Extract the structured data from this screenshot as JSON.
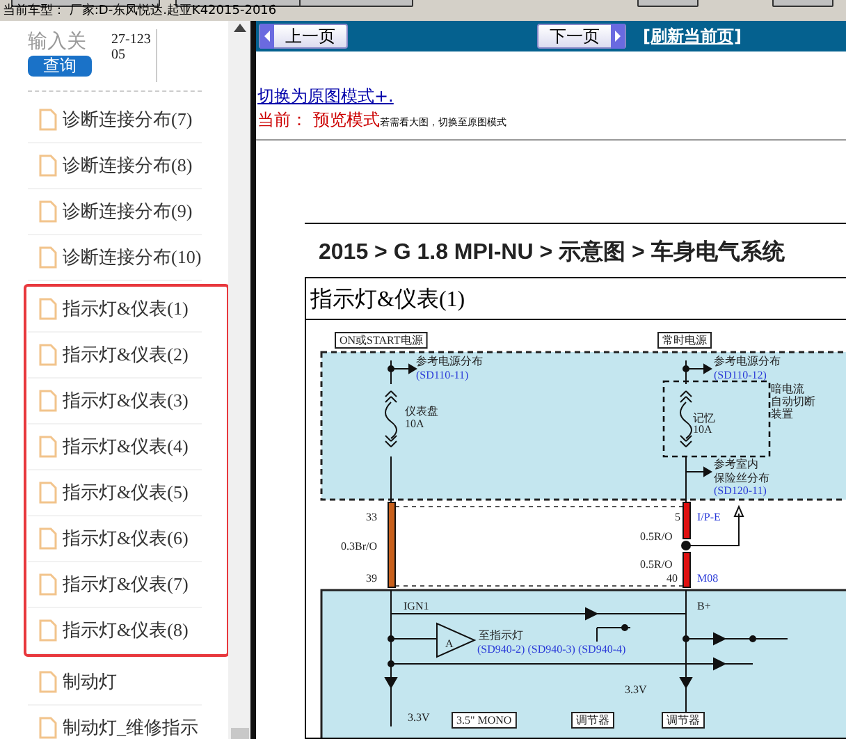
{
  "vehicle_info": "当前车型：  厂家:D-东风悦达.起亚K42015-2016",
  "sidebar": {
    "search": {
      "placeholder": "输入关",
      "value": "27-12305",
      "button": "查询"
    },
    "groups": [
      {
        "highlighted": false,
        "items": [
          "诊断连接分布(7)",
          "诊断连接分布(8)",
          "诊断连接分布(9)",
          "诊断连接分布(10)"
        ]
      },
      {
        "highlighted": true,
        "items": [
          "指示灯&仪表(1)",
          "指示灯&仪表(2)",
          "指示灯&仪表(3)",
          "指示灯&仪表(4)",
          "指示灯&仪表(5)",
          "指示灯&仪表(6)",
          "指示灯&仪表(7)",
          "指示灯&仪表(8)"
        ]
      },
      {
        "highlighted": false,
        "items": [
          "制动灯",
          "制动灯_维修指示"
        ]
      }
    ]
  },
  "viewer": {
    "prev_button": "上一页",
    "next_button": "下一页",
    "refresh_link": "[刷新当前页]",
    "mode_link": "切换为原图模式+.",
    "mode_label": "当前： 预览模式",
    "mode_hint": "若需看大图，切换至原图模式",
    "document": {
      "breadcrumb": "2015 > G 1.8 MPI-NU > 示意图 > 车身电气系统",
      "section_title": "指示灯&仪表(1)",
      "labels": [
        {
          "kind": "boxed",
          "text": "ON或START电源"
        },
        {
          "kind": "boxed",
          "text": "常时电源"
        },
        {
          "kind": "text",
          "text": "参考电源分布"
        },
        {
          "kind": "ref",
          "text": "(SD110-11)"
        },
        {
          "kind": "text",
          "text": "仪表盘"
        },
        {
          "kind": "text",
          "text": "10A"
        },
        {
          "kind": "text",
          "text": "参考电源分布"
        },
        {
          "kind": "ref",
          "text": "(SD110-12)"
        },
        {
          "kind": "text",
          "text": "暗电流"
        },
        {
          "kind": "text",
          "text": "自动切断"
        },
        {
          "kind": "text",
          "text": "装置"
        },
        {
          "kind": "text",
          "text": "记忆"
        },
        {
          "kind": "text",
          "text": "10A"
        },
        {
          "kind": "text",
          "text": "参考室内"
        },
        {
          "kind": "text",
          "text": "保险丝分布"
        },
        {
          "kind": "ref",
          "text": "(SD120-11)"
        },
        {
          "kind": "text",
          "text": "33"
        },
        {
          "kind": "text",
          "text": "0.3Br/O"
        },
        {
          "kind": "text",
          "text": "39"
        },
        {
          "kind": "text",
          "text": "5"
        },
        {
          "kind": "ref",
          "text": "I/P-E"
        },
        {
          "kind": "text",
          "text": "0.5R/O"
        },
        {
          "kind": "text",
          "text": "0.5R/O"
        },
        {
          "kind": "text",
          "text": "40"
        },
        {
          "kind": "ref",
          "text": "M08"
        },
        {
          "kind": "text",
          "text": "IGN1"
        },
        {
          "kind": "text",
          "text": "B+"
        },
        {
          "kind": "text",
          "text": "A"
        },
        {
          "kind": "text",
          "text": "至指示灯"
        },
        {
          "kind": "ref",
          "text": "(SD940-2) (SD940-3) (SD940-4)"
        },
        {
          "kind": "text",
          "text": "3.3V"
        },
        {
          "kind": "text",
          "text": "3.3V"
        },
        {
          "kind": "boxed",
          "text": "3.5\" MONO"
        },
        {
          "kind": "boxed",
          "text": "调节器"
        },
        {
          "kind": "boxed",
          "text": "调节器"
        }
      ]
    }
  }
}
